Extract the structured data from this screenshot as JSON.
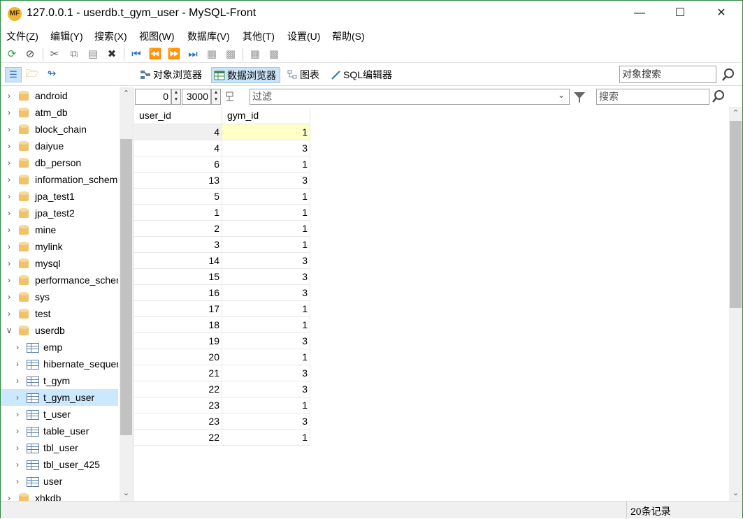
{
  "window": {
    "logo": "MF",
    "title": "127.0.0.1 - userdb.t_gym_user - MySQL-Front"
  },
  "menu": [
    "文件(Z)",
    "编辑(Y)",
    "搜索(X)",
    "视图(W)",
    "数据库(V)",
    "其他(T)",
    "设置(U)",
    "帮助(S)"
  ],
  "toolbar2": {
    "object_browser": "对象浏览器",
    "data_browser": "数据浏览器",
    "chart": "图表",
    "sql_editor": "SQL编辑器",
    "object_search": "对象搜索"
  },
  "sidebar": {
    "databases_top": [
      "android",
      "atm_db",
      "block_chain",
      "daiyue",
      "db_person",
      "information_schema",
      "jpa_test1",
      "jpa_test2",
      "mine",
      "mylink",
      "mysql",
      "performance_schema",
      "sys",
      "test"
    ],
    "expanded_db": "userdb",
    "tables": [
      "emp",
      "hibernate_sequence",
      "t_gym",
      "t_gym_user",
      "t_user",
      "table_user",
      "tbl_user",
      "tbl_user_425",
      "user"
    ],
    "selected_table": "t_gym_user",
    "databases_bottom": [
      "xhkdb"
    ]
  },
  "filter": {
    "offset": "0",
    "limit": "3000",
    "filter_placeholder": "过滤",
    "search_placeholder": "搜索"
  },
  "grid": {
    "columns": [
      "user_id",
      "gym_id"
    ],
    "rows": [
      [
        "4",
        "1"
      ],
      [
        "4",
        "3"
      ],
      [
        "6",
        "1"
      ],
      [
        "13",
        "3"
      ],
      [
        "5",
        "1"
      ],
      [
        "1",
        "1"
      ],
      [
        "2",
        "1"
      ],
      [
        "3",
        "1"
      ],
      [
        "14",
        "3"
      ],
      [
        "15",
        "3"
      ],
      [
        "16",
        "3"
      ],
      [
        "17",
        "1"
      ],
      [
        "18",
        "1"
      ],
      [
        "19",
        "3"
      ],
      [
        "20",
        "1"
      ],
      [
        "21",
        "3"
      ],
      [
        "22",
        "3"
      ],
      [
        "23",
        "1"
      ],
      [
        "23",
        "3"
      ],
      [
        "22",
        "1"
      ]
    ]
  },
  "status": {
    "record_count": "20条记录"
  },
  "colors": {
    "selected_row": "#cce8ff",
    "focused_cell": "#ffffc8",
    "db_icon": "#f2c26b"
  }
}
